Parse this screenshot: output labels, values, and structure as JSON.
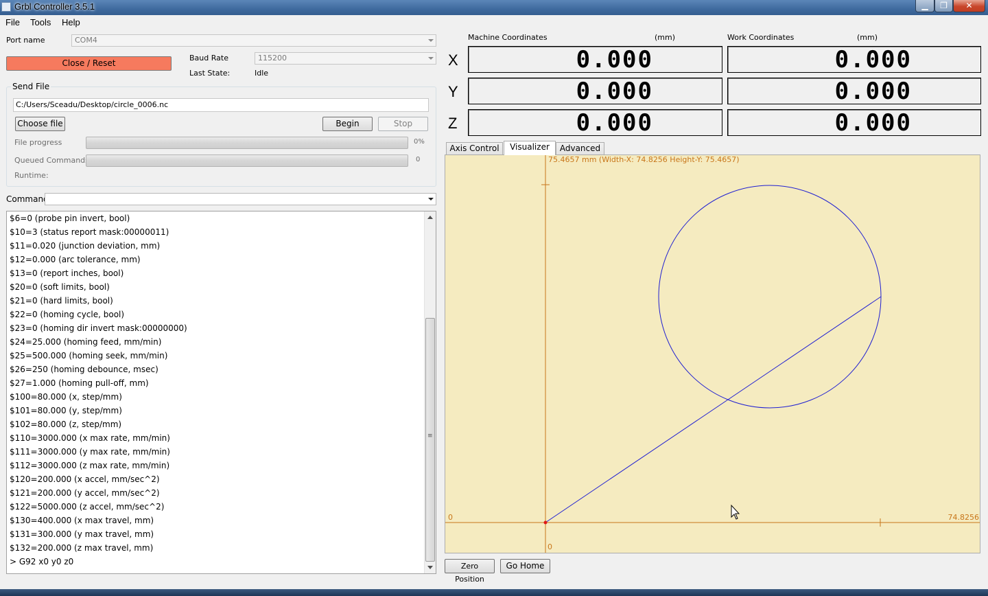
{
  "window": {
    "title": "Grbl Controller 3.5.1"
  },
  "menu": {
    "file": "File",
    "tools": "Tools",
    "help": "Help"
  },
  "connection": {
    "port_label": "Port name",
    "port_value": "COM4",
    "close_reset_label": "Close / Reset",
    "baud_label": "Baud Rate",
    "baud_value": "115200",
    "last_state_label": "Last State:",
    "last_state_value": "Idle"
  },
  "send_file": {
    "group_title": "Send File",
    "file_path": "C:/Users/Sceadu/Desktop/circle_0006.nc",
    "choose_label": "Choose file",
    "begin_label": "Begin",
    "stop_label": "Stop",
    "file_progress_label": "File progress",
    "file_progress_value": "0%",
    "file_progress_fraction": 0,
    "queued_label": "Queued Commands",
    "queued_value": "0",
    "runtime_label": "Runtime:"
  },
  "command": {
    "label": "Command",
    "value": ""
  },
  "console": {
    "lines": [
      "$6=0 (probe pin invert, bool)",
      "$10=3 (status report mask:00000011)",
      "$11=0.020 (junction deviation, mm)",
      "$12=0.000 (arc tolerance, mm)",
      "$13=0 (report inches, bool)",
      "$20=0 (soft limits, bool)",
      "$21=0 (hard limits, bool)",
      "$22=0 (homing cycle, bool)",
      "$23=0 (homing dir invert mask:00000000)",
      "$24=25.000 (homing feed, mm/min)",
      "$25=500.000 (homing seek, mm/min)",
      "$26=250 (homing debounce, msec)",
      "$27=1.000 (homing pull-off, mm)",
      "$100=80.000 (x, step/mm)",
      "$101=80.000 (y, step/mm)",
      "$102=80.000 (z, step/mm)",
      "$110=3000.000 (x max rate, mm/min)",
      "$111=3000.000 (y max rate, mm/min)",
      "$112=3000.000 (z max rate, mm/min)",
      "$120=200.000 (x accel, mm/sec^2)",
      "$121=200.000 (y accel, mm/sec^2)",
      "$122=5000.000 (z accel, mm/sec^2)",
      "$130=400.000 (x max travel, mm)",
      "$131=300.000 (y max travel, mm)",
      "$132=200.000 (z max travel, mm)",
      "> G92 x0 y0 z0"
    ]
  },
  "coordinates": {
    "machine_label": "Machine Coordinates",
    "work_label": "Work Coordinates",
    "unit": "(mm)",
    "axes": [
      "X",
      "Y",
      "Z"
    ],
    "machine": {
      "x": "0.000",
      "y": "0.000",
      "z": "0.000"
    },
    "work": {
      "x": "0.000",
      "y": "0.000",
      "z": "0.000"
    }
  },
  "tabs": {
    "axis_control": "Axis Control",
    "visualizer": "Visualizer",
    "advanced": "Advanced",
    "active": "visualizer"
  },
  "visualizer": {
    "top_label": "75.4657 mm  (Width-X: 74.8256  Height-Y: 75.4657)",
    "x_min_label": "0",
    "x_max_label": "74.8256",
    "y_min_label": "0",
    "width_x": 74.8256,
    "height_y": 75.4657,
    "colors": {
      "background": "#f5ebc0",
      "axis": "#c8761a",
      "path": "#1e1ed2",
      "origin": "#e01818"
    }
  },
  "bottom_buttons": {
    "zero_position": "Zero Position",
    "go_home": "Go Home"
  }
}
